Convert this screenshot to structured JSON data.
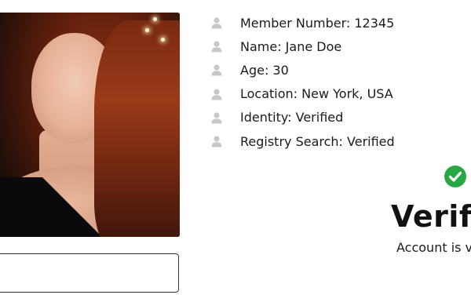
{
  "profile": {
    "photo_alt": "",
    "details": [
      {
        "icon": "user-icon",
        "text": "Member Number: 12345"
      },
      {
        "icon": "user-icon",
        "text": "Name: Jane Doe"
      },
      {
        "icon": "user-icon",
        "text": "Age: 30"
      },
      {
        "icon": "user-icon",
        "text": "Location: New York, USA"
      },
      {
        "icon": "user-icon",
        "text": "Identity: Verified"
      },
      {
        "icon": "user-icon",
        "text": "Registry Search: Verified"
      }
    ]
  },
  "verification": {
    "icon": "check-circle-icon",
    "heading": "Verif",
    "subtext": "Account is v"
  },
  "colors": {
    "icon_gray": "#c8c8c8",
    "check_green": "#27a844",
    "text": "#1a1a1a"
  }
}
